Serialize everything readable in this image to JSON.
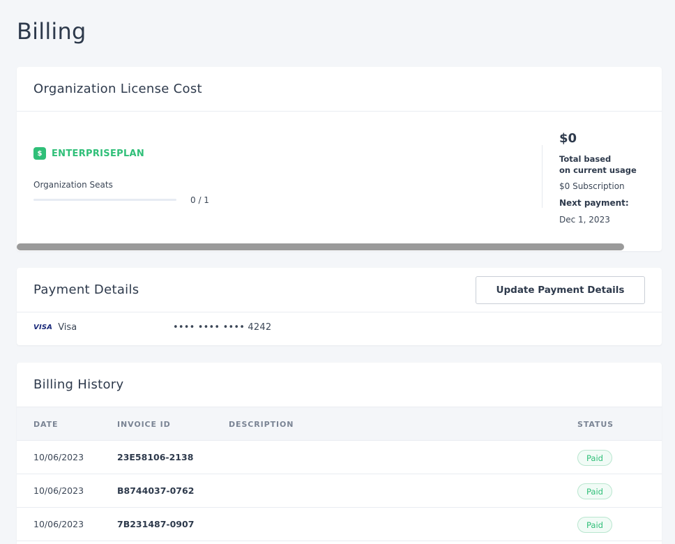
{
  "page": {
    "title": "Billing"
  },
  "license": {
    "title": "Organization License Cost",
    "plan_icon": "$",
    "plan_name": "ENTERPRISEPLAN",
    "seats_label": "Organization Seats",
    "seats_used": 0,
    "seats_total": 1,
    "seats_text": "0 / 1",
    "cost_amount": "$0",
    "cost_total_line1": "Total based",
    "cost_total_line2": "on current usage",
    "subscription": "$0 Subscription",
    "next_payment_label": "Next payment:",
    "next_payment_date": "Dec 1, 2023"
  },
  "payment": {
    "title": "Payment Details",
    "update_button": "Update Payment Details",
    "card_brand_logo": "VISA",
    "card_brand": "Visa",
    "card_number": "•••• •••• •••• 4242"
  },
  "history": {
    "title": "Billing History",
    "columns": {
      "date": "DATE",
      "invoice": "INVOICE ID",
      "description": "DESCRIPTION",
      "status": "STATUS"
    },
    "rows": [
      {
        "date": "10/06/2023",
        "invoice": "23E58106-2138",
        "description": "",
        "status": "Paid"
      },
      {
        "date": "10/06/2023",
        "invoice": "B8744037-0762",
        "description": "",
        "status": "Paid"
      },
      {
        "date": "10/06/2023",
        "invoice": "7B231487-0907",
        "description": "",
        "status": "Paid"
      }
    ]
  },
  "colors": {
    "accent_green": "#2fbf78",
    "page_bg": "#f4f6f9",
    "visa_blue": "#1a2a7a"
  }
}
